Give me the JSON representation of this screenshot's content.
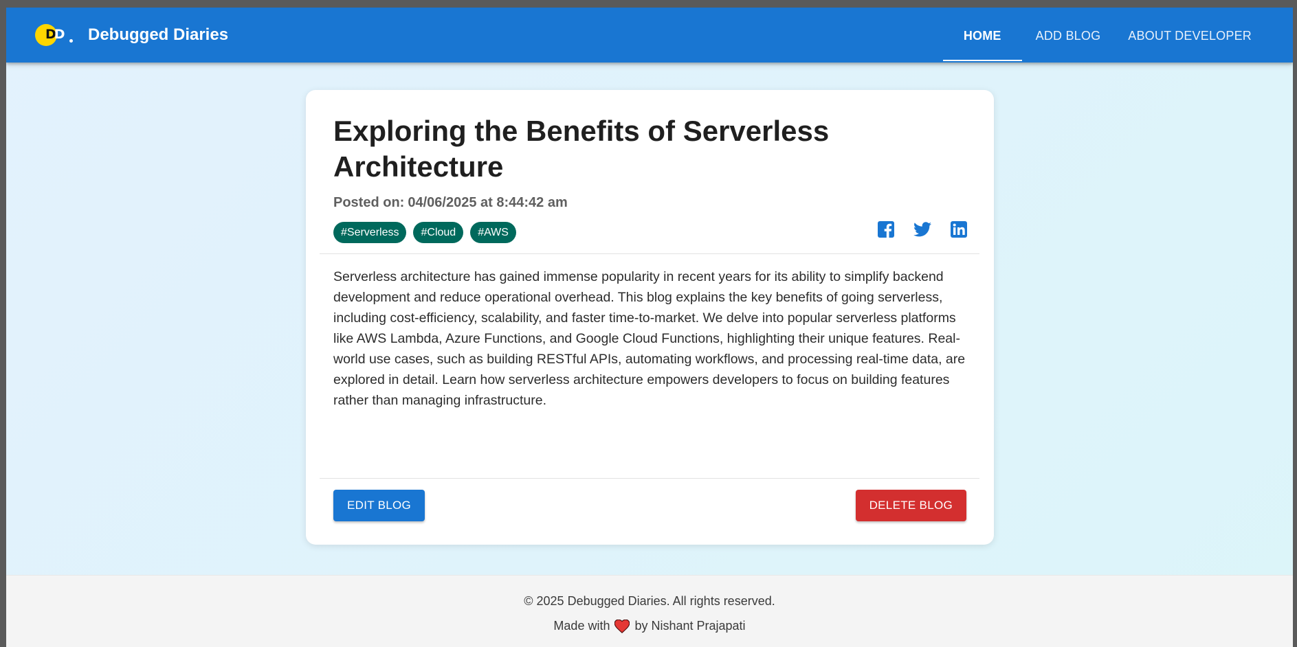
{
  "header": {
    "logo_letters": "DD",
    "brand_name": "Debugged Diaries",
    "nav": [
      {
        "label": "HOME",
        "active": true
      },
      {
        "label": "ADD BLOG",
        "active": false
      },
      {
        "label": "ABOUT DEVELOPER",
        "active": false
      }
    ]
  },
  "post": {
    "title": "Exploring the Benefits of Serverless Architecture",
    "posted_label": "Posted on:",
    "posted_date": "04/06/2025 at 8:44:42 am",
    "tags": [
      "#Serverless",
      "#Cloud",
      "#AWS"
    ],
    "share_icons": [
      "facebook-icon",
      "twitter-icon",
      "linkedin-icon"
    ],
    "content": "Serverless architecture has gained immense popularity in recent years for its ability to simplify backend development and reduce operational overhead. This blog explains the key benefits of going serverless, including cost-efficiency, scalability, and faster time-to-market. We delve into popular serverless platforms like AWS Lambda, Azure Functions, and Google Cloud Functions, highlighting their unique features. Real-world use cases, such as building RESTful APIs, automating workflows, and processing real-time data, are explored in detail. Learn how serverless architecture empowers developers to focus on building features rather than managing infrastructure.",
    "edit_label": "EDIT BLOG",
    "delete_label": "DELETE BLOG"
  },
  "footer": {
    "copyright": "© 2025 Debugged Diaries. All rights reserved.",
    "made_with": "Made with",
    "by_author": "by Nishant Prajapati"
  },
  "colors": {
    "primary": "#1976d2",
    "danger": "#d32f2f",
    "tag": "#00695c",
    "logo_yellow": "#ffd600",
    "heart": "#e53935"
  }
}
